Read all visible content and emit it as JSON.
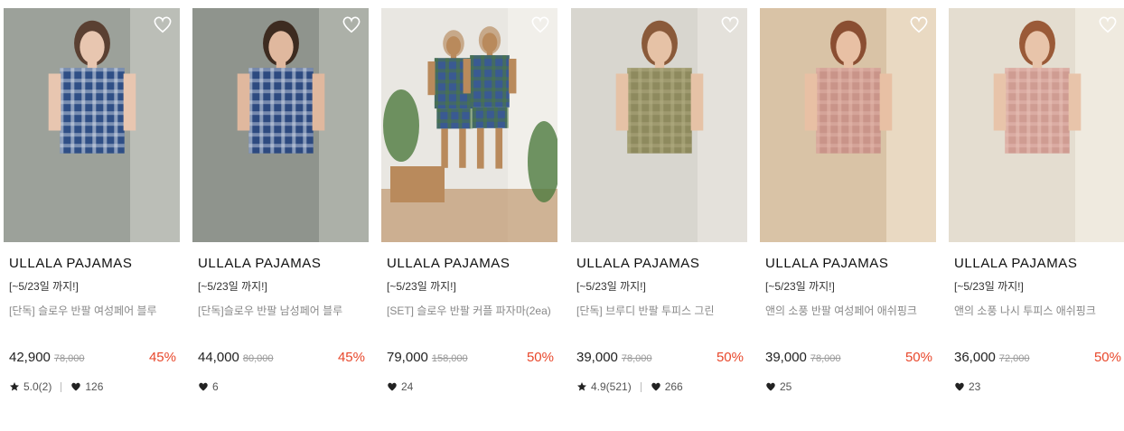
{
  "products": [
    {
      "brand": "ULLALA PAJAMAS",
      "promo": "[~5/23일 까지!]",
      "name": "[단독] 슬로우 반팔 여성페어 블루",
      "price": "42,900",
      "original_price": "78,000",
      "discount": "45%",
      "rating": "5.0(2)",
      "likes": "126",
      "image": "woman-blue-plaid-pajama",
      "palette": [
        "#9ca19a",
        "#c9cbc3",
        "#2f4f86",
        "#d9e0ea",
        "#e8c6b0",
        "#5a4032"
      ]
    },
    {
      "brand": "ULLALA PAJAMAS",
      "promo": "[~5/23일 까지!]",
      "name": "[단독]슬로우 반팔 남성페어 블루",
      "price": "44,000",
      "original_price": "80,000",
      "discount": "45%",
      "rating": "",
      "likes": "6",
      "image": "man-blue-plaid-pajama",
      "palette": [
        "#8f948d",
        "#b8bcb4",
        "#2d4a80",
        "#d4dce8",
        "#e0b89e",
        "#3d2b20"
      ]
    },
    {
      "brand": "ULLALA PAJAMAS",
      "promo": "[~5/23일 까지!]",
      "name": "[SET] 슬로우 반팔 커플 파자마(2ea)",
      "price": "79,000",
      "original_price": "158,000",
      "discount": "50%",
      "rating": "",
      "likes": "24",
      "image": "couple-blue-plaid-pajama",
      "palette": [
        "#e9e7e2",
        "#f4f2ee",
        "#3a5a92",
        "#4d7a3e",
        "#b98a5c",
        "#c7a98a"
      ]
    },
    {
      "brand": "ULLALA PAJAMAS",
      "promo": "[~5/23일 까지!]",
      "name": "[단독] 브루디 반팔 투피스 그린",
      "price": "39,000",
      "original_price": "78,000",
      "discount": "50%",
      "rating": "4.9(521)",
      "likes": "266",
      "image": "woman-green-check-pajama",
      "palette": [
        "#d8d6cf",
        "#e9e6df",
        "#8e8a5e",
        "#b3ae84",
        "#e6c2a6",
        "#8a5a3a"
      ]
    },
    {
      "brand": "ULLALA PAJAMAS",
      "promo": "[~5/23일 까지!]",
      "name": "앤의 소풍 반팔 여성페어 애쉬핑크",
      "price": "39,000",
      "original_price": "78,000",
      "discount": "50%",
      "rating": "",
      "likes": "25",
      "image": "woman-pink-check-pajama",
      "palette": [
        "#d9c3a6",
        "#efe2cf",
        "#c99489",
        "#e4b8ac",
        "#e8c0a4",
        "#8a4e32"
      ]
    },
    {
      "brand": "ULLALA PAJAMAS",
      "promo": "[~5/23일 까지!]",
      "name": "앤의 소풍 나시 투피스 애쉬핑크",
      "price": "36,000",
      "original_price": "72,000",
      "discount": "50%",
      "rating": "",
      "likes": "23",
      "image": "woman-pink-check-onepiece",
      "palette": [
        "#e4ddd0",
        "#f3efe6",
        "#cf9c92",
        "#e9c2b8",
        "#e8c4aa",
        "#9a5a38"
      ]
    }
  ],
  "colors": {
    "discount": "#e8472b",
    "brand_text": "#111111",
    "muted_text": "#888888"
  },
  "icons": {
    "wishlist": "heart-outline-icon",
    "rating": "star-icon",
    "likes": "heart-filled-icon"
  }
}
